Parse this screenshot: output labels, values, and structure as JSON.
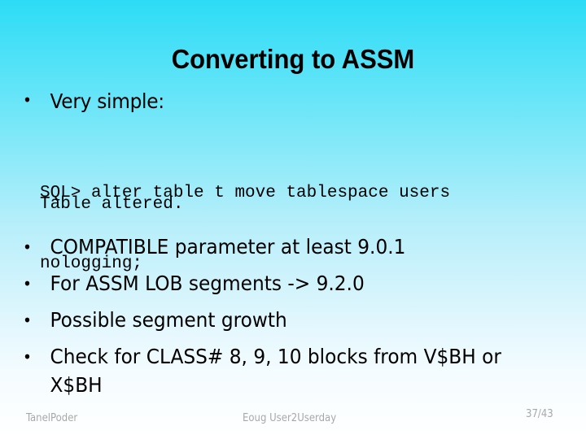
{
  "slide": {
    "title": "Converting to ASSM",
    "intro_bullet": {
      "symbol": "•",
      "text": "Very simple:"
    },
    "code_block": {
      "lines": [
        "SQL> alter table t move tablespace users",
        "nologging;"
      ],
      "result": "Table altered."
    },
    "bullets": [
      {
        "symbol": "•",
        "text": "COMPATIBLE parameter at least 9.0.1"
      },
      {
        "symbol": "•",
        "text": "For ASSM LOB segments -> 9.2.0"
      },
      {
        "symbol": "•",
        "text": "Possible segment growth"
      },
      {
        "symbol": "•",
        "text": "Check for CLASS# 8, 9, 10 blocks from V$BH or X$BH"
      }
    ]
  },
  "footer": {
    "author": "TanelPoder",
    "event": "Eoug User2Userday",
    "page": "37/43"
  },
  "colors": {
    "background_top": "#2cdcf6",
    "background_bottom": "#ffffff",
    "footer_text": "#a8a8a8"
  }
}
